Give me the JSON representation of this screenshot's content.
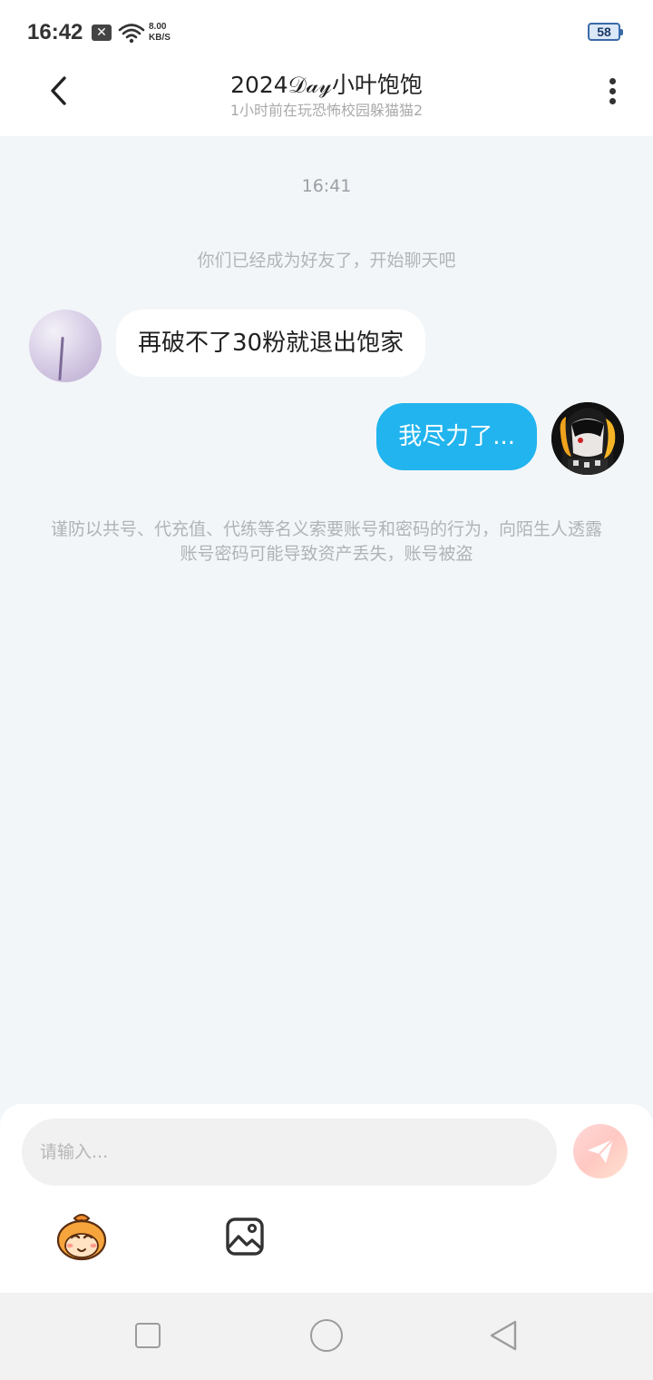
{
  "status_bar": {
    "time": "16:42",
    "network_speed_value": "8.00",
    "network_speed_unit": "KB/S",
    "battery": "58"
  },
  "header": {
    "title": "2024𝒟𝒶𝓎小叶饱饱",
    "subtitle": "1小时前在玩恐怖校园躲猫猫2"
  },
  "chat": {
    "timestamp": "16:41",
    "system_message": "你们已经成为好友了，开始聊天吧",
    "messages": [
      {
        "side": "left",
        "text": "再破不了30粉就退出饱家"
      },
      {
        "side": "right",
        "text": "我尽力了..."
      }
    ],
    "warning": "谨防以共号、代充值、代练等名义索要账号和密码的行为，向陌生人透露账号密码可能导致资产丢失，账号被盗"
  },
  "input": {
    "placeholder": "请输入..."
  },
  "colors": {
    "sent_bubble": "#22b4ee",
    "received_bubble": "#ffffff",
    "chat_background": "#f3f6f8",
    "send_button": "#ffc8c2"
  },
  "icons": {
    "back": "chevron-left-icon",
    "more": "more-vertical-icon",
    "send": "paper-plane-icon",
    "emoji": "emoji-sticker-icon",
    "image": "image-icon"
  }
}
